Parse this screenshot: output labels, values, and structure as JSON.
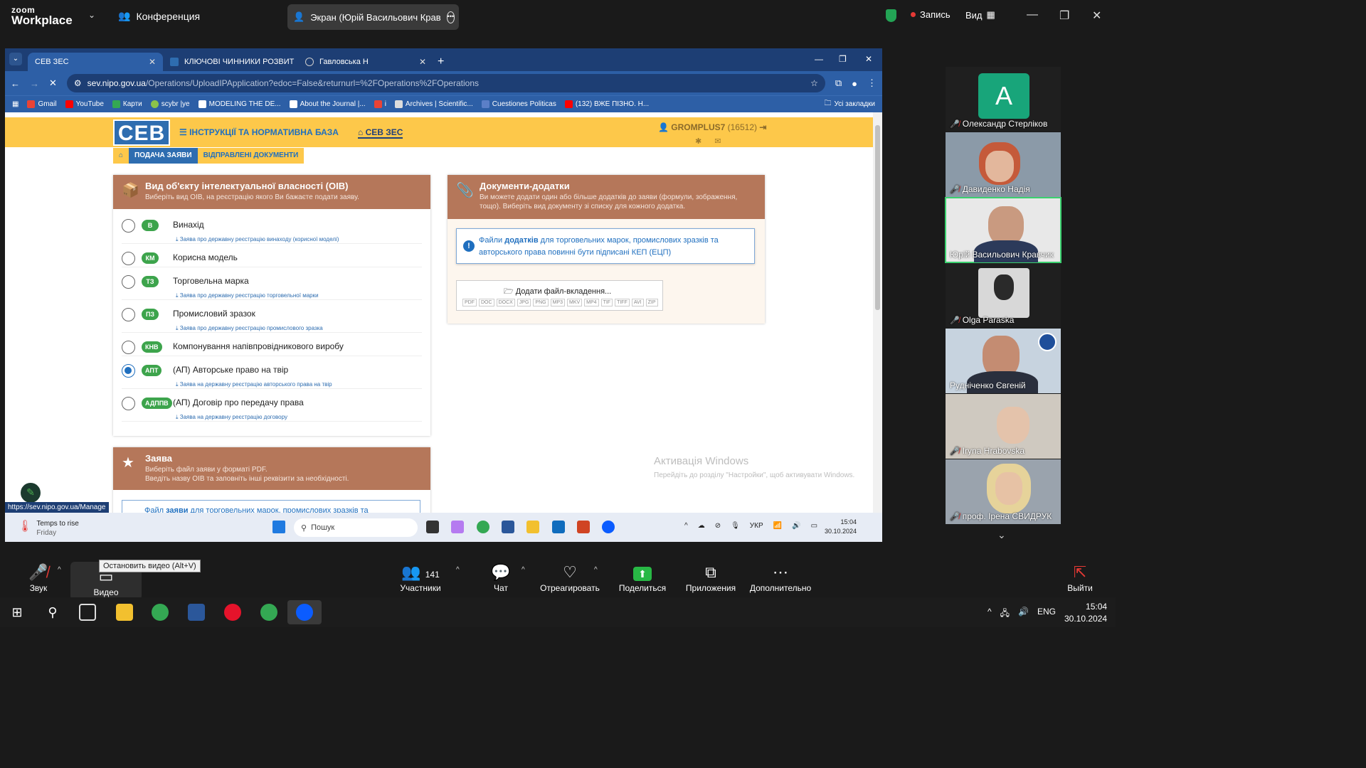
{
  "zoom": {
    "logo_line1": "zoom",
    "logo_line2": "Workplace",
    "conference_label": "Конференция",
    "screen_share_label": "Экран (Юрій Васильович Крав",
    "record_label": "Запись",
    "view_label": "Вид"
  },
  "browser": {
    "tabs": [
      {
        "label": "СЕВ ЗЕС",
        "active": true
      },
      {
        "label": "КЛЮЧОВІ ЧИННИКИ РОЗВИТ",
        "active": false
      },
      {
        "label": "Гавловська Н",
        "active": false
      }
    ],
    "url_host": "sev.nipo.gov.ua",
    "url_path": "/Operations/UploadIPApplication?edoc=False&returnurl=%2FOperations%2FOperations",
    "bookmarks": [
      "Gmail",
      "YouTube",
      "Карти",
      "scybr |ye",
      "MODELING THE DE...",
      "About the Journal |...",
      "i",
      "Archives | Scientific...",
      "Cuestiones Politicas",
      "(132) ВЖЕ ПІЗНО. Н..."
    ],
    "all_bookmarks": "Усі закладки",
    "status_url": "https://sev.nipo.gov.ua/Manage"
  },
  "sev": {
    "logo": "СЕВ",
    "nav_instructions": "ІНСТРУКЦІЇ ТА НОРМАТИВНА БАЗА",
    "nav_sev": "СЕВ ЗЕС",
    "user_name": "GROMPLUS7",
    "user_id": "(16512)",
    "subnav_submit": "ПОДАЧА ЗАЯВИ",
    "subnav_sent": "ВІДПРАВЛЕНІ ДОКУМЕНТИ",
    "oib_panel": {
      "title": "Вид об'єкту інтелектуальної власності (ОІВ)",
      "subtitle": "Виберіть вид ОІВ, на реєстрацію якого Ви бажаєте подати заяву.",
      "items": [
        {
          "badge": "В",
          "name": "Винахід",
          "link": "Заява про державну реєстрацію винаходу (корисної моделі)",
          "selected": false
        },
        {
          "badge": "КМ",
          "name": "Корисна модель",
          "link": "",
          "selected": false
        },
        {
          "badge": "ТЗ",
          "name": "Торговельна марка",
          "link": "Заява про державну реєстрацію торговельної марки",
          "selected": false
        },
        {
          "badge": "ПЗ",
          "name": "Промисловий зразок",
          "link": "Заява про державну реєстрацію промислового зразка",
          "selected": false
        },
        {
          "badge": "КНВ",
          "name": "Компонування напівпровідникового виробу",
          "link": "",
          "selected": false
        },
        {
          "badge": "АПТ",
          "name": "(АП) Авторське право на твір",
          "link": "Заява на державну реєстрацію авторського права на твір",
          "selected": true
        },
        {
          "badge": "АДППВ",
          "name": "(АП) Договір про передачу права",
          "link": "Заява на державну реєстрацію договору",
          "selected": false
        }
      ]
    },
    "docs_panel": {
      "title": "Документи-додатки",
      "subtitle": "Ви можете додати один або більше додатків до заяви (формули, зображення, тощо). Виберіть вид документу зі списку для кожного додатка.",
      "alert_pre": "Файли ",
      "alert_bold": "додатків",
      "alert_post": " для торговельних марок, промислових зразків та авторського права повинні бути підписані КЕП (ЕЦП)",
      "upload_label": "Додати файл-вкладення...",
      "formats": [
        "PDF",
        "DOC",
        "DOCX",
        "JPG",
        "PNG",
        "MP3",
        "MKV",
        "MP4",
        "TIF",
        "TIFF",
        "AVI",
        "ZIP"
      ]
    },
    "app_panel": {
      "title": "Заява",
      "subtitle1": "Виберіть файл заяви у форматі PDF.",
      "subtitle2": "Введіть назву ОІВ та заповніть інші реквізити за необхідності.",
      "alert_pre": "Файл ",
      "alert_bold": "заяви",
      "alert_post": " для торговельних марок, промислових зразків та"
    },
    "windows_activation_title": "Активація Windows",
    "windows_activation_text": "Перейдіть до розділу \"Настройки\", щоб активувати Windows."
  },
  "inner_taskbar": {
    "weather_title": "Temps to rise",
    "weather_sub": "Friday",
    "search_placeholder": "Пошук",
    "lang": "УКР",
    "time": "15:04",
    "date": "30.10.2024"
  },
  "participants": [
    {
      "name": "Олександр Стерліков",
      "initial": "А",
      "speaking": false
    },
    {
      "name": "Давиденко Надія",
      "speaking": false
    },
    {
      "name": "Юрій Васильович Кравчик",
      "speaking": true
    },
    {
      "name": "Olga Paraska",
      "speaking": false
    },
    {
      "name": "Рудніченко Євгеній",
      "speaking": false
    },
    {
      "name": "Iryna  Hrabovska",
      "speaking": false
    },
    {
      "name": "проф. Ірена СВИДРУК",
      "speaking": false
    }
  ],
  "toolbar": {
    "audio": "Звук",
    "video": "Видео",
    "video_tooltip": "Остановить видео (Alt+V)",
    "participants": "Участники",
    "participants_count": "141",
    "chat": "Чат",
    "react": "Отреагировать",
    "share": "Поделиться",
    "apps": "Приложения",
    "more": "Дополнительно",
    "leave": "Выйти"
  },
  "windows": {
    "lang": "ENG",
    "time": "15:04",
    "date": "30.10.2024"
  },
  "colors": {
    "sev_yellow": "#fdc84a",
    "sev_blue": "#2e6db0",
    "panel_header": "#b5775a",
    "badge_green": "#3da44c",
    "zoom_green": "#28b845"
  }
}
